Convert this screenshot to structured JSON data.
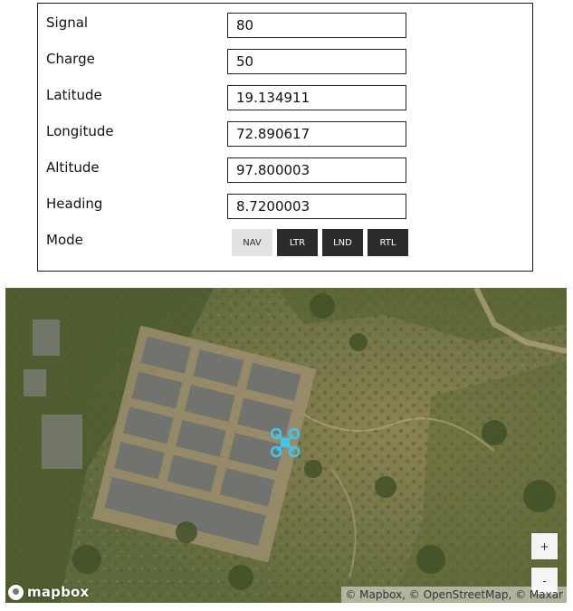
{
  "telemetry": {
    "fields": [
      {
        "label": "Signal",
        "value": "80"
      },
      {
        "label": "Charge",
        "value": "50"
      },
      {
        "label": "Latitude",
        "value": "19.134911"
      },
      {
        "label": "Longitude",
        "value": "72.890617"
      },
      {
        "label": "Altitude",
        "value": "97.800003"
      },
      {
        "label": "Heading",
        "value": "8.7200003"
      }
    ],
    "mode_label": "Mode",
    "modes": [
      {
        "label": "NAV",
        "active": true
      },
      {
        "label": "LTR",
        "active": false
      },
      {
        "label": "LND",
        "active": false
      },
      {
        "label": "RTL",
        "active": false
      }
    ]
  },
  "map": {
    "marker_icon": "drone-icon",
    "marker_color": "#3ec8f0",
    "zoom_in_label": "+",
    "zoom_out_label": "-",
    "logo_text": "mapbox",
    "attribution": "© Mapbox, © OpenStreetMap, © Maxar"
  }
}
